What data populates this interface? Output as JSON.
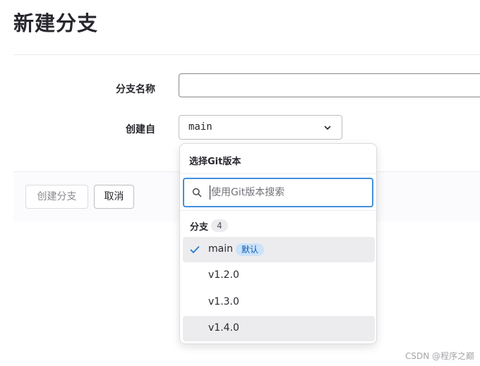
{
  "page": {
    "title": "新建分支"
  },
  "form": {
    "branch_name": {
      "label": "分支名称",
      "value": ""
    },
    "create_from": {
      "label": "创建自",
      "value": "main",
      "icon": "chevron-down-icon"
    }
  },
  "actions": {
    "create_label": "创建分支",
    "cancel_label": "取消"
  },
  "dropdown": {
    "title": "选择Git版本",
    "search": {
      "placeholder": "使用Git版本搜索",
      "value": "",
      "icon": "search-icon"
    },
    "group": {
      "label": "分支",
      "count": "4"
    },
    "items": [
      {
        "label": "main",
        "badge": "默认",
        "selected": true,
        "icon": "check-icon"
      },
      {
        "label": "v1.2.0"
      },
      {
        "label": "v1.3.0"
      },
      {
        "label": "v1.4.0"
      }
    ]
  },
  "watermark": "CSDN @程序之巅",
  "colors": {
    "accent": "#428fdc",
    "badge_bg": "#cbe2f9",
    "badge_text": "#0b5cad",
    "hover_bg": "#ececef"
  }
}
